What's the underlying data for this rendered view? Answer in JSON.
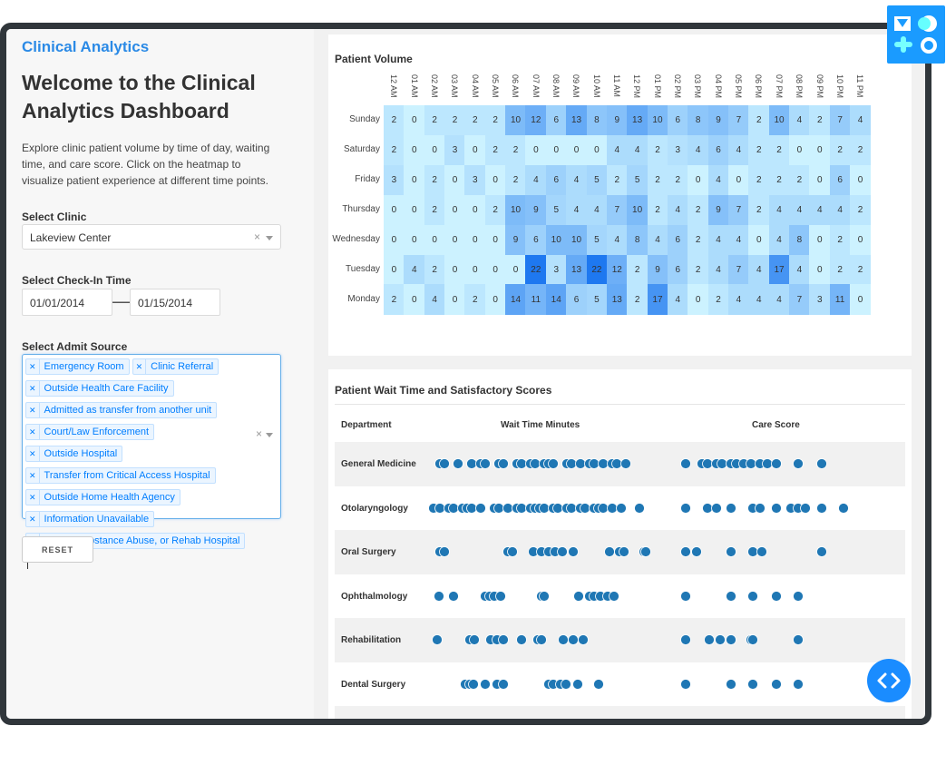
{
  "sidebar": {
    "brand": "Clinical Analytics",
    "welcome": "Welcome to the Clinical Analytics Dashboard",
    "intro": "Explore clinic patient volume by time of day, waiting time, and care score. Click on the heatmap to visualize patient experience at different time points.",
    "clinic_label": "Select Clinic",
    "clinic_value": "Lakeview Center",
    "checkin_label": "Select Check-In Time",
    "date_start": "01/01/2014",
    "date_end": "01/15/2014",
    "admit_label": "Select Admit Source",
    "admit_sources": [
      "Emergency Room",
      "Clinic Referral",
      "Outside Health Care Facility",
      "Admitted as transfer from another unit",
      "Court/Law Enforcement",
      "Outside Hospital",
      "Transfer from Critical Access Hospital",
      "Outside Home Health Agency",
      "Information Unavailable",
      "Psych, Substance Abuse, or Rehab Hospital"
    ],
    "reset_label": "RESET"
  },
  "colors": {
    "brand": "#2b8ae6",
    "dot": "#1f77b4",
    "accent": "#1a8cff"
  },
  "chart_data": [
    {
      "type": "heatmap",
      "title": "Patient Volume",
      "x": [
        "12 AM",
        "01 AM",
        "02 AM",
        "03 AM",
        "04 AM",
        "05 AM",
        "06 AM",
        "07 AM",
        "08 AM",
        "09 AM",
        "10 AM",
        "11 AM",
        "12 PM",
        "01 PM",
        "02 PM",
        "03 PM",
        "04 PM",
        "05 PM",
        "06 PM",
        "07 PM",
        "08 PM",
        "09 PM",
        "10 PM",
        "11 PM"
      ],
      "y": [
        "Sunday",
        "Saturday",
        "Friday",
        "Thursday",
        "Wednesday",
        "Tuesday",
        "Monday"
      ],
      "z": [
        [
          2,
          0,
          2,
          2,
          2,
          2,
          10,
          12,
          6,
          13,
          8,
          9,
          13,
          10,
          6,
          8,
          9,
          7,
          2,
          10,
          4,
          2,
          7,
          4
        ],
        [
          2,
          0,
          0,
          3,
          0,
          2,
          2,
          0,
          0,
          0,
          0,
          4,
          4,
          2,
          3,
          4,
          6,
          4,
          2,
          2,
          0,
          0,
          2,
          2
        ],
        [
          3,
          0,
          2,
          0,
          3,
          0,
          2,
          4,
          6,
          4,
          5,
          2,
          5,
          2,
          2,
          0,
          4,
          0,
          2,
          2,
          2,
          0,
          6,
          0
        ],
        [
          0,
          0,
          2,
          0,
          0,
          2,
          10,
          9,
          5,
          4,
          4,
          7,
          10,
          2,
          4,
          2,
          9,
          7,
          2,
          4,
          4,
          4,
          4,
          2
        ],
        [
          0,
          0,
          0,
          0,
          0,
          0,
          9,
          6,
          10,
          10,
          5,
          4,
          8,
          4,
          6,
          2,
          4,
          4,
          0,
          4,
          8,
          0,
          2,
          0
        ],
        [
          0,
          4,
          2,
          0,
          0,
          0,
          0,
          22,
          3,
          13,
          22,
          12,
          2,
          9,
          6,
          2,
          4,
          7,
          4,
          17,
          4,
          0,
          2,
          2
        ],
        [
          2,
          0,
          4,
          0,
          2,
          0,
          14,
          11,
          14,
          6,
          5,
          13,
          2,
          17,
          4,
          0,
          2,
          4,
          4,
          4,
          7,
          3,
          11,
          0
        ]
      ]
    },
    {
      "type": "scatter",
      "title": "Patient Wait Time and Satisfactory Scores",
      "columns": [
        "Department",
        "Wait Time Minutes",
        "Care Score"
      ],
      "rows": [
        {
          "department": "General Medicine",
          "wait": [
            7.5,
            10,
            17.5,
            25,
            30,
            32.5,
            40,
            42.5,
            50,
            52.5,
            57.5,
            60,
            65,
            67.5,
            70,
            77.5,
            80,
            85,
            90,
            92.5,
            97.5,
            102.5,
            105,
            110
          ],
          "care": [
            1.3,
            2.2,
            2.5,
            3,
            3.3,
            3.8,
            4.1,
            4.5,
            4.9,
            5.4,
            5.8,
            6.3,
            7.5,
            8.8
          ]
        },
        {
          "department": "Otolaryngology",
          "wait": [
            4,
            7.5,
            12.5,
            15,
            20,
            22.5,
            25,
            30,
            37.5,
            40,
            45,
            50,
            52.5,
            57.5,
            60,
            62.5,
            65,
            70,
            72.5,
            77.5,
            80,
            85,
            87.5,
            92.5,
            95,
            97.5,
            102.5,
            107.5,
            117.5
          ],
          "care": [
            1.3,
            2.5,
            3,
            3.8,
            5,
            5.4,
            6.3,
            7.1,
            7.5,
            7.9,
            8.8,
            10
          ]
        },
        {
          "department": "Oral Surgery",
          "wait": [
            7.5,
            10,
            45,
            47.5,
            59,
            63.5,
            67.5,
            71,
            75,
            81,
            101,
            106.5,
            109,
            120,
            121
          ],
          "care": [
            1.3,
            1.9,
            3.8,
            5,
            5.5,
            8.8
          ]
        },
        {
          "department": "Ophthalmology",
          "wait": [
            7,
            15,
            32.5,
            35,
            37.5,
            41,
            63.5,
            65,
            84,
            90,
            92.5,
            96,
            100,
            103.5
          ],
          "care": [
            1.3,
            3.8,
            5,
            6.3,
            7.5
          ]
        },
        {
          "department": "Rehabilitation",
          "wait": [
            6,
            24,
            26.5,
            35.5,
            39,
            42.5,
            52.5,
            61.5,
            63.5,
            75.5,
            81,
            86.5
          ],
          "care": [
            1.3,
            2.6,
            3.2,
            3.8,
            4.9,
            5,
            7.5
          ]
        },
        {
          "department": "Dental Surgery",
          "wait": [
            21.5,
            24,
            26,
            32.5,
            39,
            42.5,
            67.5,
            70,
            74,
            77,
            83.5,
            95
          ],
          "care": [
            1.3,
            3.8,
            5,
            6.3,
            7.5
          ]
        }
      ]
    }
  ]
}
